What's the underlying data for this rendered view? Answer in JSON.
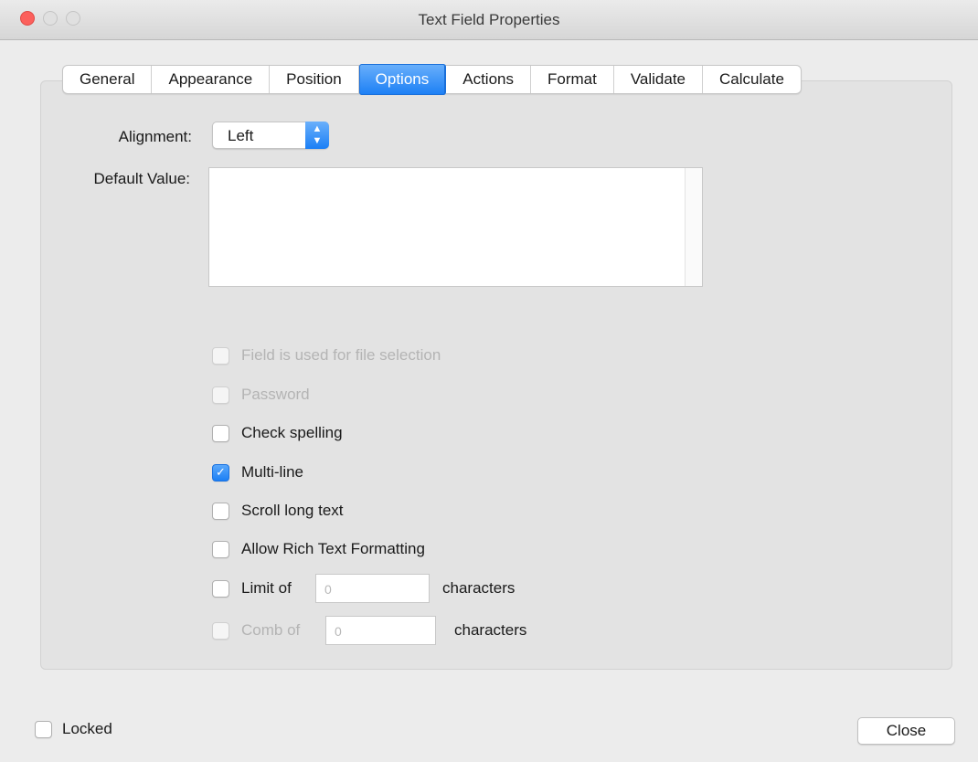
{
  "window": {
    "title": "Text Field Properties"
  },
  "tabs": [
    {
      "label": "General",
      "active": false
    },
    {
      "label": "Appearance",
      "active": false
    },
    {
      "label": "Position",
      "active": false
    },
    {
      "label": "Options",
      "active": true
    },
    {
      "label": "Actions",
      "active": false
    },
    {
      "label": "Format",
      "active": false
    },
    {
      "label": "Validate",
      "active": false
    },
    {
      "label": "Calculate",
      "active": false
    }
  ],
  "options": {
    "alignment_label": "Alignment:",
    "alignment_value": "Left",
    "default_value_label": "Default Value:",
    "default_value": "",
    "checkboxes": {
      "file_selection": {
        "label": "Field is used for file selection",
        "checked": false,
        "enabled": false
      },
      "password": {
        "label": "Password",
        "checked": false,
        "enabled": false
      },
      "check_spelling": {
        "label": "Check spelling",
        "checked": false,
        "enabled": true
      },
      "multi_line": {
        "label": "Multi-line",
        "checked": true,
        "enabled": true
      },
      "scroll_long_text": {
        "label": "Scroll long text",
        "checked": false,
        "enabled": true
      },
      "rich_text": {
        "label": "Allow Rich Text Formatting",
        "checked": false,
        "enabled": true
      },
      "limit_of": {
        "label": "Limit of",
        "checked": false,
        "enabled": true,
        "value": "0",
        "suffix": "characters"
      },
      "comb_of": {
        "label": "Comb of",
        "checked": false,
        "enabled": false,
        "value": "0",
        "suffix": "characters"
      }
    }
  },
  "footer": {
    "locked_label": "Locked",
    "locked_checked": false,
    "close_label": "Close"
  },
  "colors": {
    "accent": "#1b7ff5",
    "close_light": "#fc605c"
  }
}
